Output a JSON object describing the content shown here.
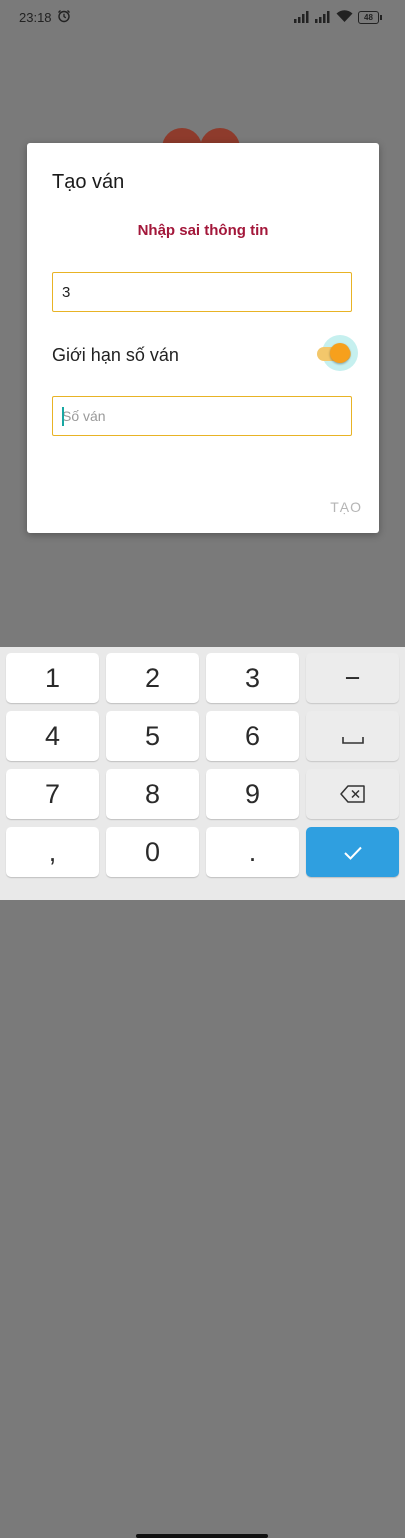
{
  "status_bar": {
    "time": "23:18",
    "battery": "48",
    "icons": [
      "alarm-icon",
      "signal-icon",
      "signal-icon",
      "wifi-icon",
      "battery-icon"
    ]
  },
  "dialog": {
    "title": "Tạo ván",
    "error_message": "Nhập sai thông tin",
    "field1_value": "3",
    "limit_label": "Giới hạn số ván",
    "limit_toggle_on": true,
    "field2_placeholder": "Số ván",
    "create_button": "TẠO"
  },
  "colors": {
    "error_text": "#a3173a",
    "field_border": "#e8b325",
    "toggle_thumb": "#f7a01c",
    "done_key": "#2f9fe0"
  },
  "keyboard": {
    "keys": [
      "1",
      "2",
      "3",
      "−",
      "4",
      "5",
      "6",
      "space",
      "7",
      "8",
      "9",
      "backspace",
      ",",
      "0",
      ".",
      "done"
    ],
    "labels": {
      "k1": "1",
      "k2": "2",
      "k3": "3",
      "minus": "−",
      "k4": "4",
      "k5": "5",
      "k6": "6",
      "k7": "7",
      "k8": "8",
      "k9": "9",
      "comma": ",",
      "k0": "0",
      "dot": "."
    }
  }
}
